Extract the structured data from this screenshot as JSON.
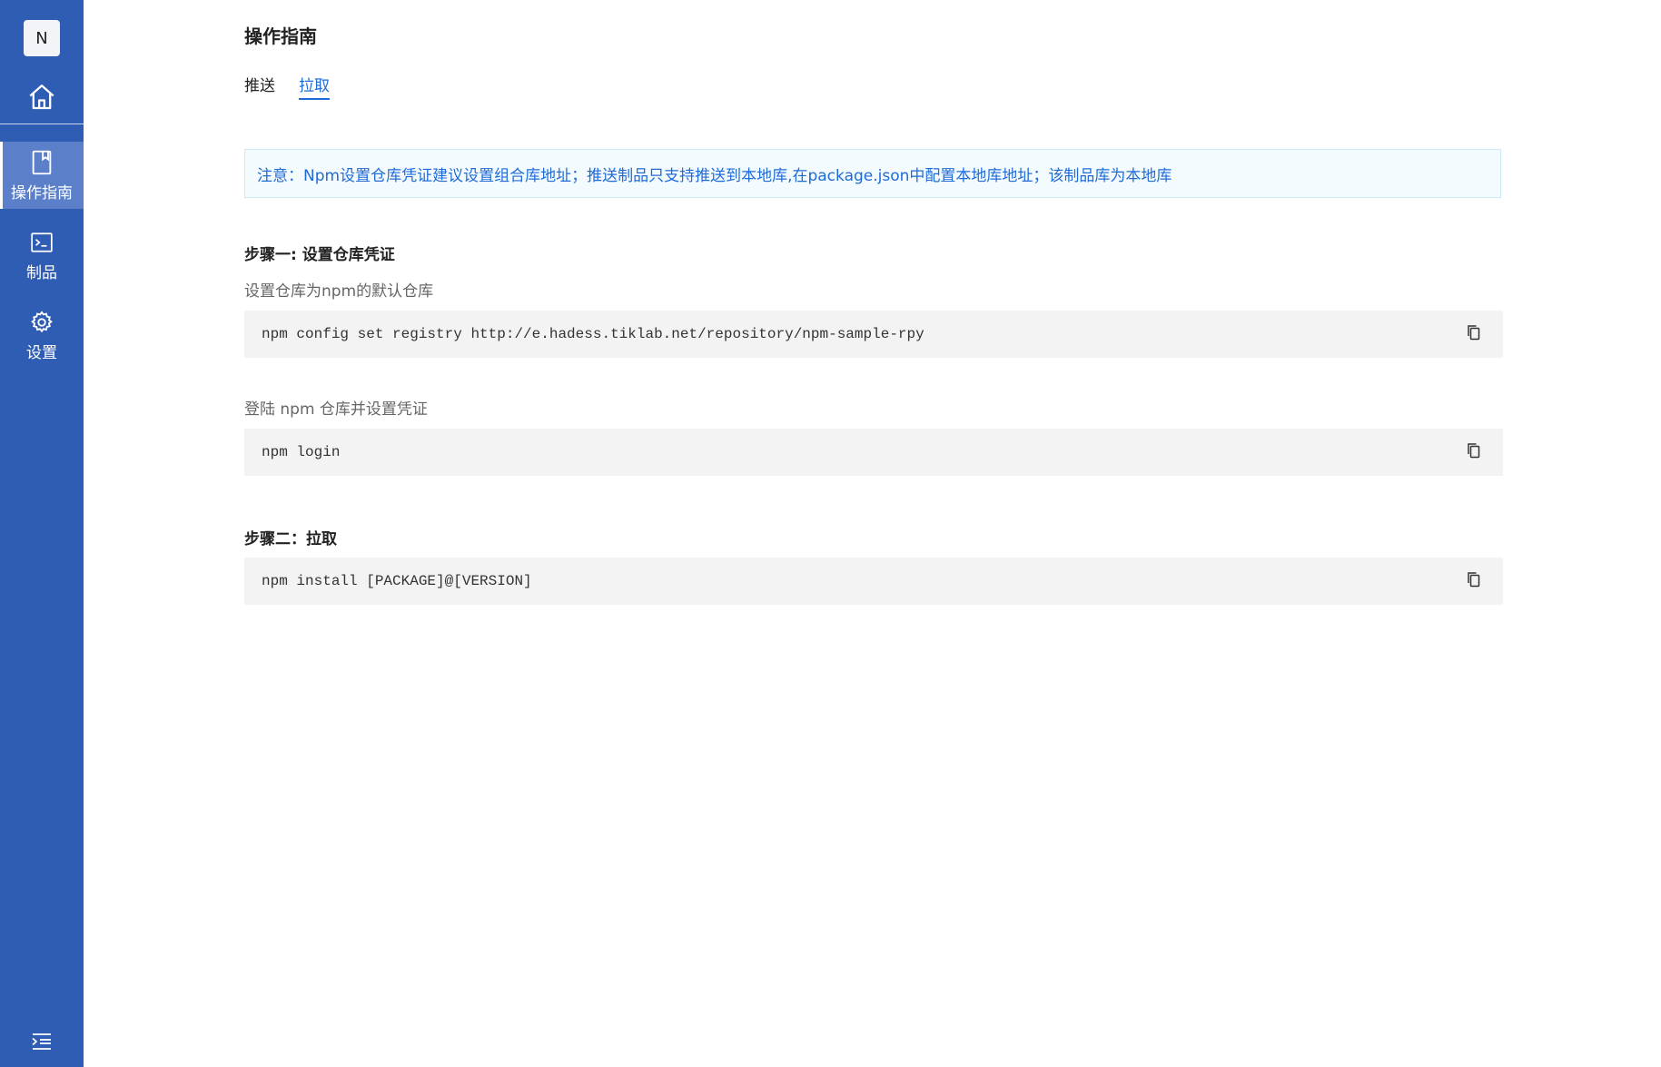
{
  "sidebar": {
    "avatar_letter": "N",
    "items": [
      {
        "label": "操作指南",
        "icon": "book-icon",
        "active": true
      },
      {
        "label": "制品",
        "icon": "terminal-icon",
        "active": false
      },
      {
        "label": "设置",
        "icon": "gear-icon",
        "active": false
      }
    ],
    "colors": {
      "background": "#2f5db3",
      "active": "#5b80c9"
    }
  },
  "main": {
    "title": "操作指南",
    "tabs": [
      {
        "label": "推送",
        "active": false
      },
      {
        "label": "拉取",
        "active": true
      }
    ],
    "notice": "注意：Npm设置仓库凭证建议设置组合库地址；推送制品只支持推送到本地库,在package.json中配置本地库地址；该制品库为本地库",
    "step1": {
      "title": "步骤一: 设置仓库凭证",
      "desc1": "设置仓库为npm的默认仓库",
      "code1": "npm config set registry http://e.hadess.tiklab.net/repository/npm-sample-rpy",
      "desc2": "登陆 npm 仓库并设置凭证",
      "code2": "npm login"
    },
    "step2": {
      "title": "步骤二：拉取",
      "code": "npm install [PACKAGE]@[VERSION]"
    }
  },
  "colors": {
    "accent": "#1f6bd6",
    "notice_bg": "#f3fbfe",
    "code_bg": "#f3f3f3"
  }
}
